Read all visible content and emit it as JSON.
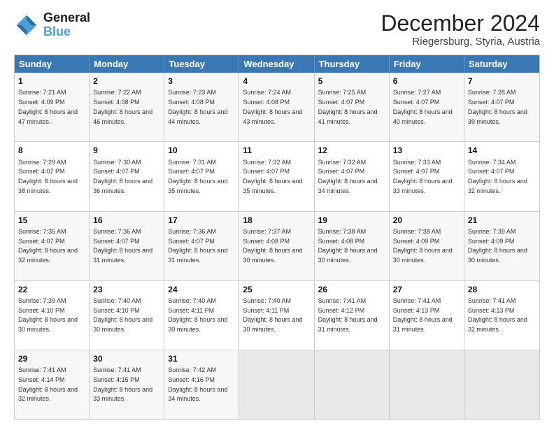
{
  "header": {
    "logo_line1": "General",
    "logo_line2": "Blue",
    "month": "December 2024",
    "location": "Riegersburg, Styria, Austria"
  },
  "days_of_week": [
    "Sunday",
    "Monday",
    "Tuesday",
    "Wednesday",
    "Thursday",
    "Friday",
    "Saturday"
  ],
  "weeks": [
    [
      {
        "day": "1",
        "sunrise": "7:21 AM",
        "sunset": "4:09 PM",
        "daylight": "8 hours and 47 minutes."
      },
      {
        "day": "2",
        "sunrise": "7:22 AM",
        "sunset": "4:08 PM",
        "daylight": "8 hours and 46 minutes."
      },
      {
        "day": "3",
        "sunrise": "7:23 AM",
        "sunset": "4:08 PM",
        "daylight": "8 hours and 44 minutes."
      },
      {
        "day": "4",
        "sunrise": "7:24 AM",
        "sunset": "4:08 PM",
        "daylight": "8 hours and 43 minutes."
      },
      {
        "day": "5",
        "sunrise": "7:25 AM",
        "sunset": "4:07 PM",
        "daylight": "8 hours and 41 minutes."
      },
      {
        "day": "6",
        "sunrise": "7:27 AM",
        "sunset": "4:07 PM",
        "daylight": "8 hours and 40 minutes."
      },
      {
        "day": "7",
        "sunrise": "7:28 AM",
        "sunset": "4:07 PM",
        "daylight": "8 hours and 39 minutes."
      }
    ],
    [
      {
        "day": "8",
        "sunrise": "7:29 AM",
        "sunset": "4:07 PM",
        "daylight": "8 hours and 38 minutes."
      },
      {
        "day": "9",
        "sunrise": "7:30 AM",
        "sunset": "4:07 PM",
        "daylight": "8 hours and 36 minutes."
      },
      {
        "day": "10",
        "sunrise": "7:31 AM",
        "sunset": "4:07 PM",
        "daylight": "8 hours and 35 minutes."
      },
      {
        "day": "11",
        "sunrise": "7:32 AM",
        "sunset": "4:07 PM",
        "daylight": "8 hours and 35 minutes."
      },
      {
        "day": "12",
        "sunrise": "7:32 AM",
        "sunset": "4:07 PM",
        "daylight": "8 hours and 34 minutes."
      },
      {
        "day": "13",
        "sunrise": "7:33 AM",
        "sunset": "4:07 PM",
        "daylight": "8 hours and 33 minutes."
      },
      {
        "day": "14",
        "sunrise": "7:34 AM",
        "sunset": "4:07 PM",
        "daylight": "8 hours and 32 minutes."
      }
    ],
    [
      {
        "day": "15",
        "sunrise": "7:35 AM",
        "sunset": "4:07 PM",
        "daylight": "8 hours and 32 minutes."
      },
      {
        "day": "16",
        "sunrise": "7:36 AM",
        "sunset": "4:07 PM",
        "daylight": "8 hours and 31 minutes."
      },
      {
        "day": "17",
        "sunrise": "7:36 AM",
        "sunset": "4:07 PM",
        "daylight": "8 hours and 31 minutes."
      },
      {
        "day": "18",
        "sunrise": "7:37 AM",
        "sunset": "4:08 PM",
        "daylight": "8 hours and 30 minutes."
      },
      {
        "day": "19",
        "sunrise": "7:38 AM",
        "sunset": "4:08 PM",
        "daylight": "8 hours and 30 minutes."
      },
      {
        "day": "20",
        "sunrise": "7:38 AM",
        "sunset": "4:09 PM",
        "daylight": "8 hours and 30 minutes."
      },
      {
        "day": "21",
        "sunrise": "7:39 AM",
        "sunset": "4:09 PM",
        "daylight": "8 hours and 30 minutes."
      }
    ],
    [
      {
        "day": "22",
        "sunrise": "7:39 AM",
        "sunset": "4:10 PM",
        "daylight": "8 hours and 30 minutes."
      },
      {
        "day": "23",
        "sunrise": "7:40 AM",
        "sunset": "4:10 PM",
        "daylight": "8 hours and 30 minutes."
      },
      {
        "day": "24",
        "sunrise": "7:40 AM",
        "sunset": "4:11 PM",
        "daylight": "8 hours and 30 minutes."
      },
      {
        "day": "25",
        "sunrise": "7:40 AM",
        "sunset": "4:11 PM",
        "daylight": "8 hours and 30 minutes."
      },
      {
        "day": "26",
        "sunrise": "7:41 AM",
        "sunset": "4:12 PM",
        "daylight": "8 hours and 31 minutes."
      },
      {
        "day": "27",
        "sunrise": "7:41 AM",
        "sunset": "4:13 PM",
        "daylight": "8 hours and 31 minutes."
      },
      {
        "day": "28",
        "sunrise": "7:41 AM",
        "sunset": "4:13 PM",
        "daylight": "8 hours and 32 minutes."
      }
    ],
    [
      {
        "day": "29",
        "sunrise": "7:41 AM",
        "sunset": "4:14 PM",
        "daylight": "8 hours and 32 minutes."
      },
      {
        "day": "30",
        "sunrise": "7:41 AM",
        "sunset": "4:15 PM",
        "daylight": "8 hours and 33 minutes."
      },
      {
        "day": "31",
        "sunrise": "7:42 AM",
        "sunset": "4:16 PM",
        "daylight": "8 hours and 34 minutes."
      },
      null,
      null,
      null,
      null
    ]
  ]
}
